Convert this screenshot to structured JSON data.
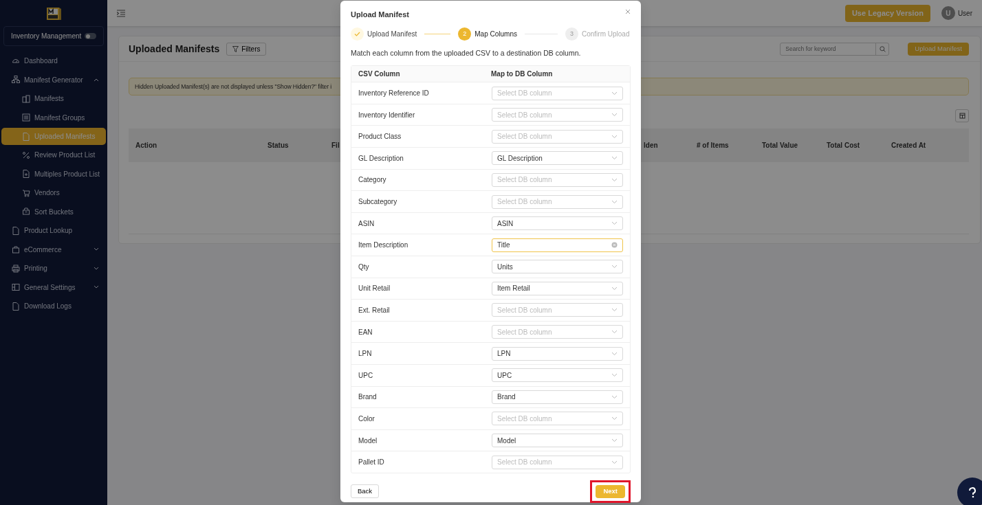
{
  "sidebar": {
    "section_switch": {
      "label": "Inventory Management",
      "on": false
    },
    "items": [
      {
        "label": "Dashboard",
        "active": false
      },
      {
        "label": "Manifest Generator",
        "expanded": true,
        "active": false,
        "children": [
          {
            "label": "Manifests",
            "active": false
          },
          {
            "label": "Manifest Groups",
            "active": false
          },
          {
            "label": "Uploaded Manifests",
            "active": true
          },
          {
            "label": "Review Product List",
            "active": false
          },
          {
            "label": "Multiples Product List",
            "active": false
          },
          {
            "label": "Vendors",
            "active": false
          },
          {
            "label": "Sort Buckets",
            "active": false
          }
        ]
      },
      {
        "label": "Product Lookup",
        "active": false
      },
      {
        "label": "eCommerce",
        "expanded": false,
        "active": false
      },
      {
        "label": "Printing",
        "expanded": false,
        "active": false
      },
      {
        "label": "General Settings",
        "expanded": false,
        "active": false
      },
      {
        "label": "Download Logs",
        "active": false
      }
    ]
  },
  "topbar": {
    "legacy_button": "Use Legacy Version",
    "avatar": "U",
    "user": "User"
  },
  "page": {
    "title": "Uploaded Manifests",
    "filters_button": "Filters",
    "search": {
      "placeholder": "Search for keyword"
    },
    "upload_button": "Upload Manifest",
    "alert": "Hidden Uploaded Manifest(s) are not displayed unless \"Show Hidden?\" filter i",
    "table": {
      "columns": [
        "Action",
        "Status",
        "Fil",
        "lden",
        "# of Items",
        "Total Value",
        "Total Cost",
        "Created At"
      ]
    }
  },
  "modal": {
    "title": "Upload Manifest",
    "steps": [
      {
        "label": "Upload Manifest",
        "done": true,
        "selected": false
      },
      {
        "number": "2",
        "label": "Map Columns",
        "done": false,
        "selected": true
      },
      {
        "number": "3",
        "label": "Confirm Upload",
        "done": false,
        "selected": false
      }
    ],
    "description": "Match each column from the uploaded CSV to a destination DB column.",
    "columns": [
      "CSV Column",
      "Map to DB Column"
    ],
    "rows": [
      {
        "csv": "Inventory Reference ID",
        "placeholder": "Select DB column"
      },
      {
        "csv": "Inventory Identifier",
        "placeholder": "Select DB column"
      },
      {
        "csv": "Product Class",
        "placeholder": "Select DB column"
      },
      {
        "csv": "GL Description",
        "value": "GL Description"
      },
      {
        "csv": "Category",
        "placeholder": "Select DB column"
      },
      {
        "csv": "Subcategory",
        "placeholder": "Select DB column"
      },
      {
        "csv": "ASIN",
        "value": "ASIN"
      },
      {
        "csv": "Item Description",
        "value": "Title",
        "focused": true
      },
      {
        "csv": "Qty",
        "value": "Units"
      },
      {
        "csv": "Unit Retail",
        "value": "Item Retail"
      },
      {
        "csv": "Ext. Retail",
        "placeholder": "Select DB column"
      },
      {
        "csv": "EAN",
        "placeholder": "Select DB column"
      },
      {
        "csv": "LPN",
        "value": "LPN"
      },
      {
        "csv": "UPC",
        "value": "UPC"
      },
      {
        "csv": "Brand",
        "value": "Brand"
      },
      {
        "csv": "Color",
        "placeholder": "Select DB column"
      },
      {
        "csv": "Model",
        "value": "Model"
      },
      {
        "csv": "Pallet ID",
        "placeholder": "Select DB column"
      }
    ],
    "back_button": "Back",
    "next_button": {
      "label": "Next",
      "highlighted": true
    }
  }
}
